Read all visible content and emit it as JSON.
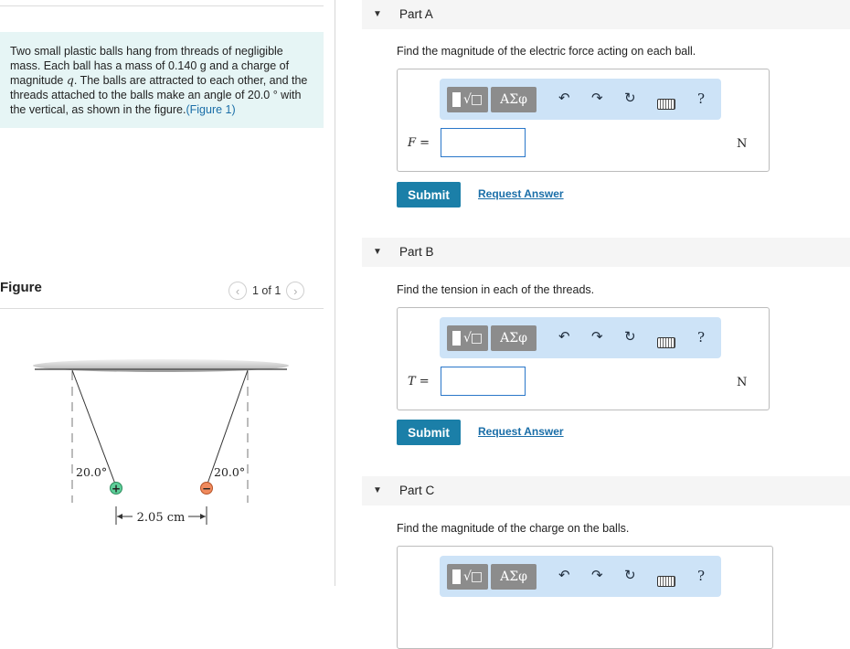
{
  "problem": {
    "text_1": "Two small plastic balls hang from threads of negligible mass. Each ball has a mass of 0.140 g and a charge of magnitude ",
    "var_q": "q",
    "text_2": ". The balls are attracted to each other, and the threads attached to the balls make an angle of 20.0 ° with the vertical, as shown in the figure.",
    "figure_link": "(Figure 1)"
  },
  "figure": {
    "title": "Figure",
    "page_indicator": "1 of 1",
    "prev_icon": "chevron-left-icon",
    "next_icon": "chevron-right-icon",
    "angle_left": "20.0°",
    "angle_right": "20.0°",
    "distance": "2.05 cm",
    "plus_sign": "+",
    "minus_sign": "−"
  },
  "parts": {
    "a": {
      "title": "Part A",
      "question": "Find the magnitude of the electric force acting on each ball.",
      "var": "F",
      "eq": " =",
      "unit": "N",
      "submit": "Submit",
      "request": "Request Answer"
    },
    "b": {
      "title": "Part B",
      "question": "Find the tension in each of the threads.",
      "var": "T",
      "eq": " =",
      "unit": "N",
      "submit": "Submit",
      "request": "Request Answer"
    },
    "c": {
      "title": "Part C",
      "question": "Find the magnitude of the charge on the balls."
    }
  },
  "toolbar": {
    "greek_label": "ΑΣφ",
    "radical_label": "√□",
    "undo_icon": "↶",
    "redo_icon": "↷",
    "reset_icon": "↻",
    "help_label": "?"
  },
  "colors": {
    "problem_bg": "#e6f5f5",
    "submit_bg": "#1b7fa8",
    "toolbar_bg": "#cde3f7",
    "link": "#1a6ea8",
    "plus_ball": "#5ecf9a",
    "minus_ball": "#f08a5d"
  }
}
